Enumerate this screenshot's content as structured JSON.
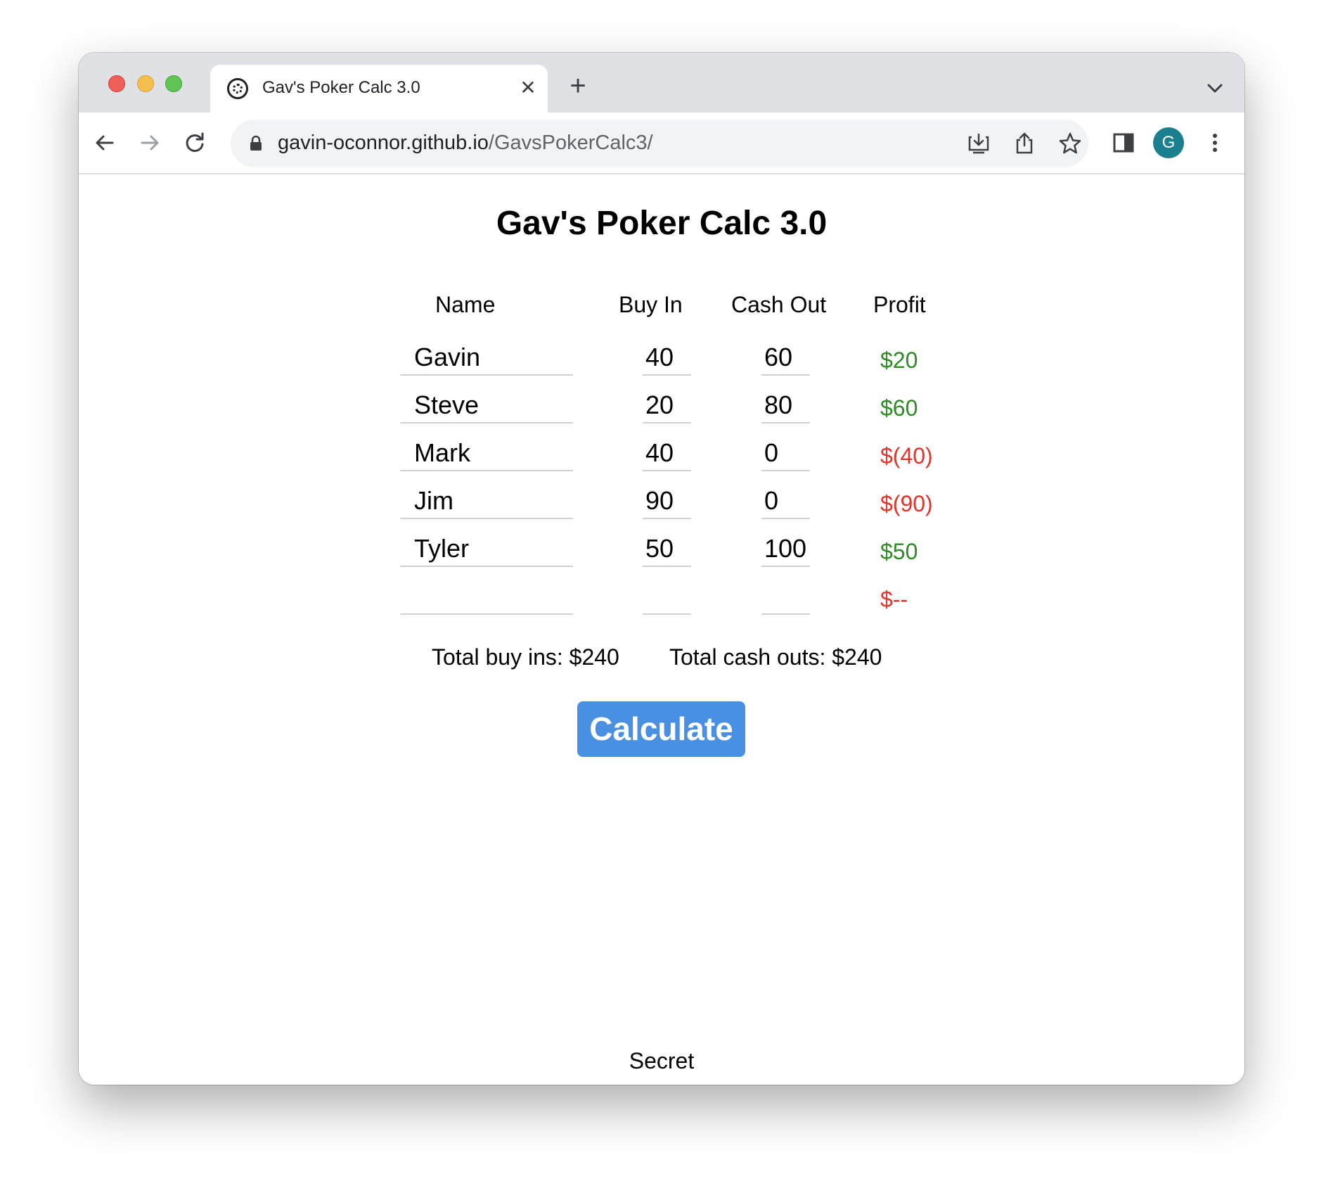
{
  "browser": {
    "tab_title": "Gav's Poker Calc 3.0",
    "tab_favicon": "poker-chip-icon",
    "close_tab_symbol": "✕",
    "new_tab_symbol": "+",
    "url_host": "gavin-oconnor.github.io",
    "url_path": "/GavsPokerCalc3/",
    "avatar_initial": "G",
    "avatar_color": "#1a7f8e",
    "icons": [
      "back-arrow-icon",
      "forward-arrow-icon",
      "reload-icon",
      "lock-icon",
      "install-icon",
      "share-icon",
      "bookmark-star-icon",
      "side-panel-icon",
      "kebab-menu-icon",
      "tab-list-chevron-icon"
    ]
  },
  "page": {
    "title": "Gav's Poker Calc 3.0",
    "columns": {
      "name": "Name",
      "buy_in": "Buy In",
      "cash_out": "Cash Out",
      "profit": "Profit"
    },
    "rows": [
      {
        "name": "Gavin",
        "buy_in": "40",
        "cash_out": "60",
        "profit": "$20",
        "profit_sign": "positive"
      },
      {
        "name": "Steve",
        "buy_in": "20",
        "cash_out": "80",
        "profit": "$60",
        "profit_sign": "positive"
      },
      {
        "name": "Mark",
        "buy_in": "40",
        "cash_out": "0",
        "profit": "$(40)",
        "profit_sign": "negative"
      },
      {
        "name": "Jim",
        "buy_in": "90",
        "cash_out": "0",
        "profit": "$(90)",
        "profit_sign": "negative"
      },
      {
        "name": "Tyler",
        "buy_in": "50",
        "cash_out": "100",
        "profit": "$50",
        "profit_sign": "positive"
      },
      {
        "name": "",
        "buy_in": "",
        "cash_out": "",
        "profit": "$--",
        "profit_sign": "negative"
      }
    ],
    "total_buy_ins": "Total buy ins: $240",
    "total_cash_outs": "Total cash outs: $240",
    "calculate_label": "Calculate",
    "secret_label": "Secret",
    "colors": {
      "positive": "#2e8b24",
      "negative": "#e2332b",
      "button": "#4a90e2"
    }
  }
}
